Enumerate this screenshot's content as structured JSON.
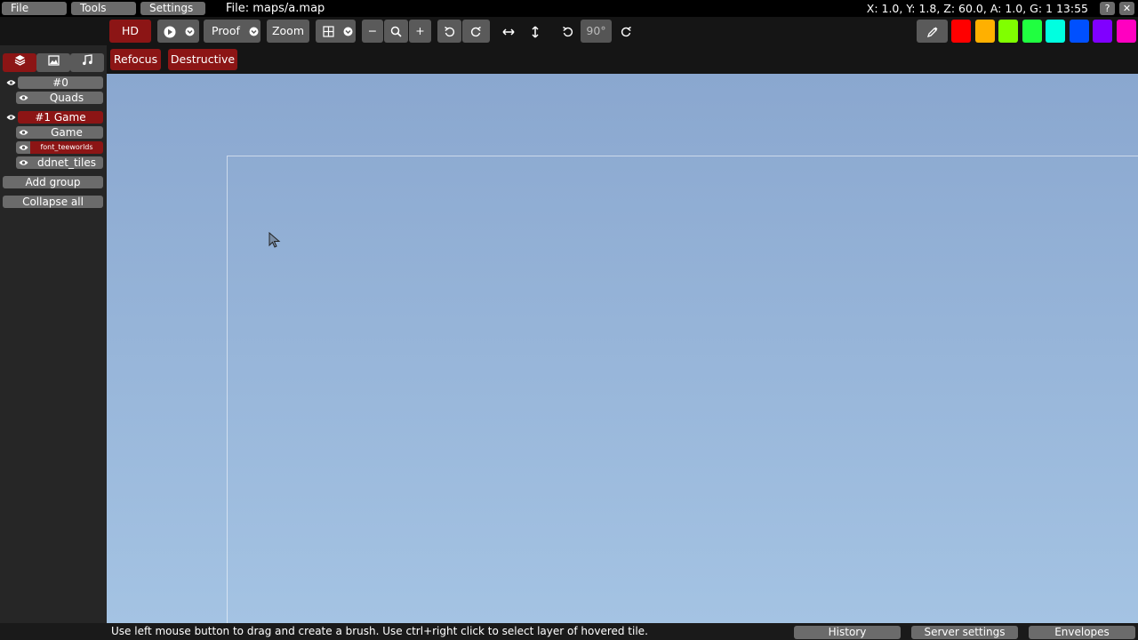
{
  "menubar": {
    "file": "File",
    "tools": "Tools",
    "settings": "Settings",
    "file_title": "File: maps/a.map",
    "coords": "X: 1.0, Y: 1.8, Z: 60.0, A: 1.0, G: 1  13:55",
    "help": "?",
    "close": "✕"
  },
  "toolbar": {
    "hd": "HD",
    "proof": "Proof",
    "zoom": "Zoom",
    "zoom_out": "−",
    "zoom_in": "+",
    "rotate_value": "90°",
    "colors": [
      "#ff0000",
      "#ffb000",
      "#80ff00",
      "#20ff40",
      "#00ffe0",
      "#0050ff",
      "#8000ff",
      "#ff00c0"
    ]
  },
  "toolbar2": {
    "refocus": "Refocus",
    "destructive": "Destructive"
  },
  "sidebar": {
    "group0": "#0",
    "layer_quads": "Quads",
    "group1": "#1 Game",
    "layer_game": "Game",
    "layer_font": "font_teeworlds",
    "layer_tiles": "ddnet_tiles",
    "add_group": "Add group",
    "collapse_all": "Collapse all"
  },
  "statusbar": {
    "hint": "Use left mouse button to drag and create a brush. Use ctrl+right click to select layer of hovered tile.",
    "history": "History",
    "server_settings": "Server settings",
    "envelopes": "Envelopes"
  }
}
